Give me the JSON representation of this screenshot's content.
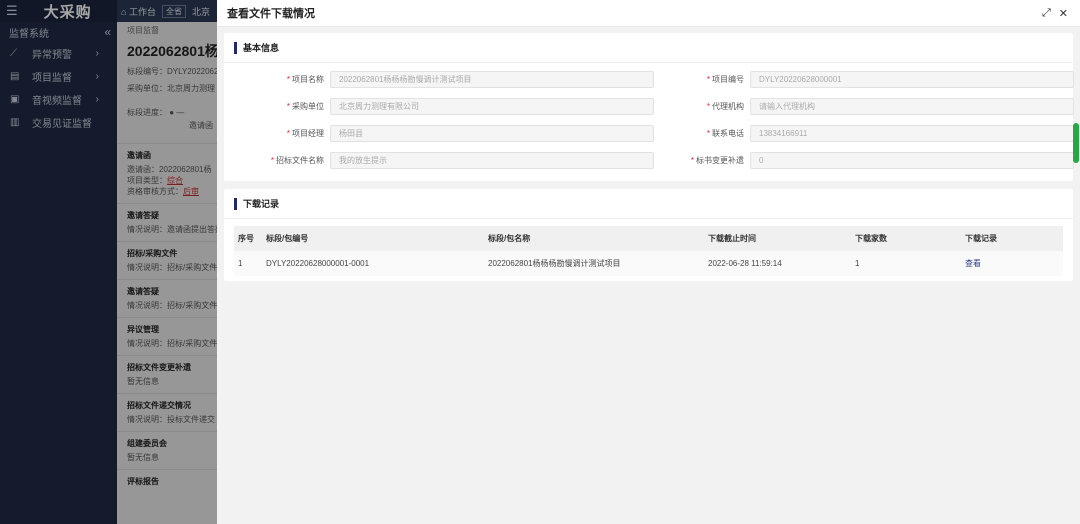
{
  "app": {
    "brand": "大采购",
    "system_label": "监督系统",
    "nav": [
      {
        "icon": "chart-icon",
        "glyph": "⟋",
        "label": "异常预警"
      },
      {
        "icon": "doc-icon",
        "glyph": "▤",
        "label": "项目监督"
      },
      {
        "icon": "video-icon",
        "glyph": "▣",
        "label": "音视频监督"
      },
      {
        "icon": "credential-icon",
        "glyph": "▥",
        "label": "交易见证监督"
      }
    ],
    "topbar": {
      "home": "工作台",
      "tag1": "全省",
      "tag2": "北京"
    },
    "crumb": "项目监督",
    "project_title": "2022062801杨",
    "meta1": "标段编号：DYLY2022062",
    "meta2": "采购单位：北京周力测理",
    "progress_label": "标段进度：",
    "stage": "邀请函",
    "sections": [
      {
        "head": "邀请函",
        "lines": [
          "邀请函：2022062801杨",
          "项目类型：",
          "资格审核方式："
        ],
        "links": [
          "",
          "综合",
          "后审"
        ]
      },
      {
        "head": "邀请答疑",
        "lines": [
          "情况说明：邀请函提出答疑"
        ]
      },
      {
        "head": "招标/采购文件",
        "lines": [
          "情况说明：招标/采购文件"
        ]
      },
      {
        "head": "邀请答疑",
        "lines": [
          "情况说明：招标/采购文件"
        ]
      },
      {
        "head": "异议管理",
        "lines": [
          "情况说明：招标/采购文件"
        ]
      },
      {
        "head": "招标文件变更补遗",
        "lines": [
          "暂无信息"
        ]
      },
      {
        "head": "招标文件递交情况",
        "lines": [
          "情况说明：投标文件递交"
        ]
      },
      {
        "head": "组建委员会",
        "lines": [
          "暂无信息"
        ]
      },
      {
        "head": "评标报告",
        "lines": []
      }
    ]
  },
  "drawer": {
    "title": "查看文件下载情况",
    "expand_glyph": "⤢",
    "close_glyph": "✕",
    "basic_section_title": "基本信息",
    "fields": {
      "project_name": {
        "label": "项目名称",
        "value": "2022062801杨杨杨勘慢调计测试项目"
      },
      "project_code": {
        "label": "项目编号",
        "value": "DYLY20220628000001"
      },
      "purchaser": {
        "label": "采购单位",
        "value": "北京周力测理有限公司"
      },
      "agency": {
        "label": "代理机构",
        "placeholder": "请输入代理机构"
      },
      "manager": {
        "label": "项目经理",
        "value": "杨田县"
      },
      "phone": {
        "label": "联系电话",
        "value": "13834166911"
      },
      "bid_file_name": {
        "label": "招标文件名称",
        "value": "我的放生提示"
      },
      "change_addendum": {
        "label": "标书变更补遗",
        "value": "0"
      }
    },
    "download_section_title": "下载记录",
    "table": {
      "headers": [
        "序号",
        "标段/包编号",
        "标段/包名称",
        "下载截止时间",
        "下载家数",
        "下载记录"
      ],
      "rows": [
        {
          "index": "1",
          "code": "DYLY20220628000001-0001",
          "name": "2022062801杨杨杨勘慢调计测试项目",
          "deadline": "2022-06-28 11:59:14",
          "count": "1",
          "action": "查看"
        }
      ]
    }
  }
}
